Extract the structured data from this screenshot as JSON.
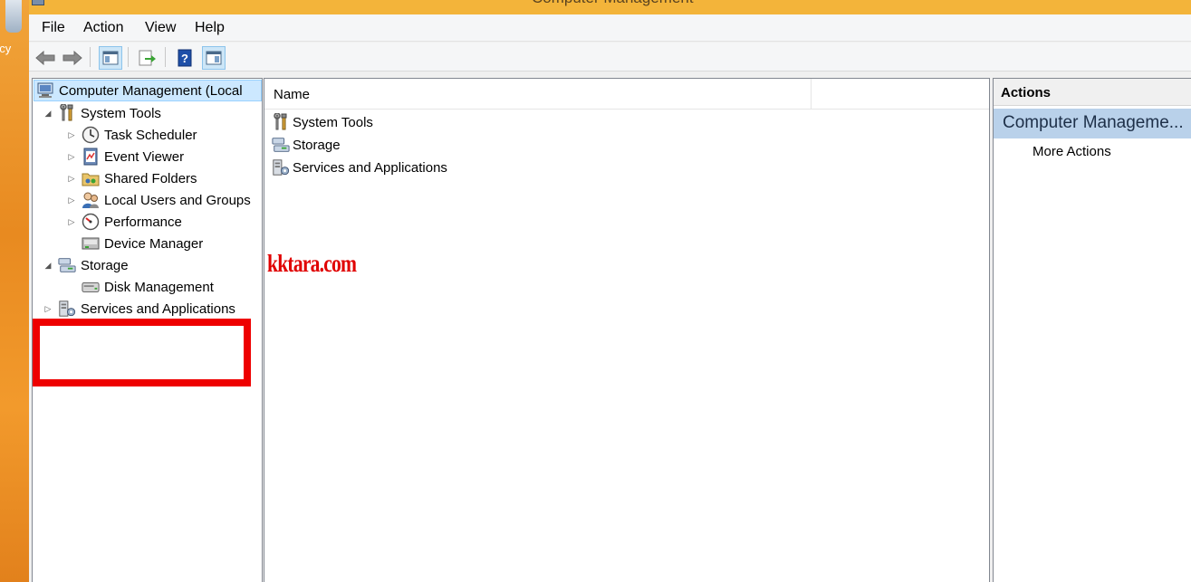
{
  "desktop": {
    "label": "ecy"
  },
  "window": {
    "title": "Computer Management"
  },
  "menu": [
    "File",
    "Action",
    "View",
    "Help"
  ],
  "toolbar": {
    "buttons": [
      "back-arrow-icon",
      "forward-arrow-icon",
      "show-hide-console-tree-icon",
      "export-list-icon",
      "help-icon",
      "show-hide-action-pane-icon"
    ]
  },
  "tree": {
    "root": "Computer Management (Local",
    "items": [
      {
        "label": "System Tools",
        "icon": "tools-icon"
      },
      {
        "label": "Task Scheduler",
        "icon": "clock-icon"
      },
      {
        "label": "Event Viewer",
        "icon": "event-viewer-icon"
      },
      {
        "label": "Shared Folders",
        "icon": "shared-folder-icon"
      },
      {
        "label": "Local Users and Groups",
        "icon": "users-icon"
      },
      {
        "label": "Performance",
        "icon": "performance-icon"
      },
      {
        "label": "Device Manager",
        "icon": "device-manager-icon"
      },
      {
        "label": "Storage",
        "icon": "storage-icon"
      },
      {
        "label": "Disk Management",
        "icon": "disk-icon"
      },
      {
        "label": "Services and Applications",
        "icon": "services-icon"
      }
    ]
  },
  "list": {
    "column_header": "Name",
    "rows": [
      {
        "label": "System Tools",
        "icon": "tools-icon"
      },
      {
        "label": "Storage",
        "icon": "storage-icon"
      },
      {
        "label": "Services and Applications",
        "icon": "services-icon"
      }
    ]
  },
  "actions": {
    "header": "Actions",
    "selected": "Computer Manageme...",
    "more": "More Actions"
  },
  "overlay": {
    "watermark": "kktara.com",
    "highlight_color": "#ee0000"
  }
}
